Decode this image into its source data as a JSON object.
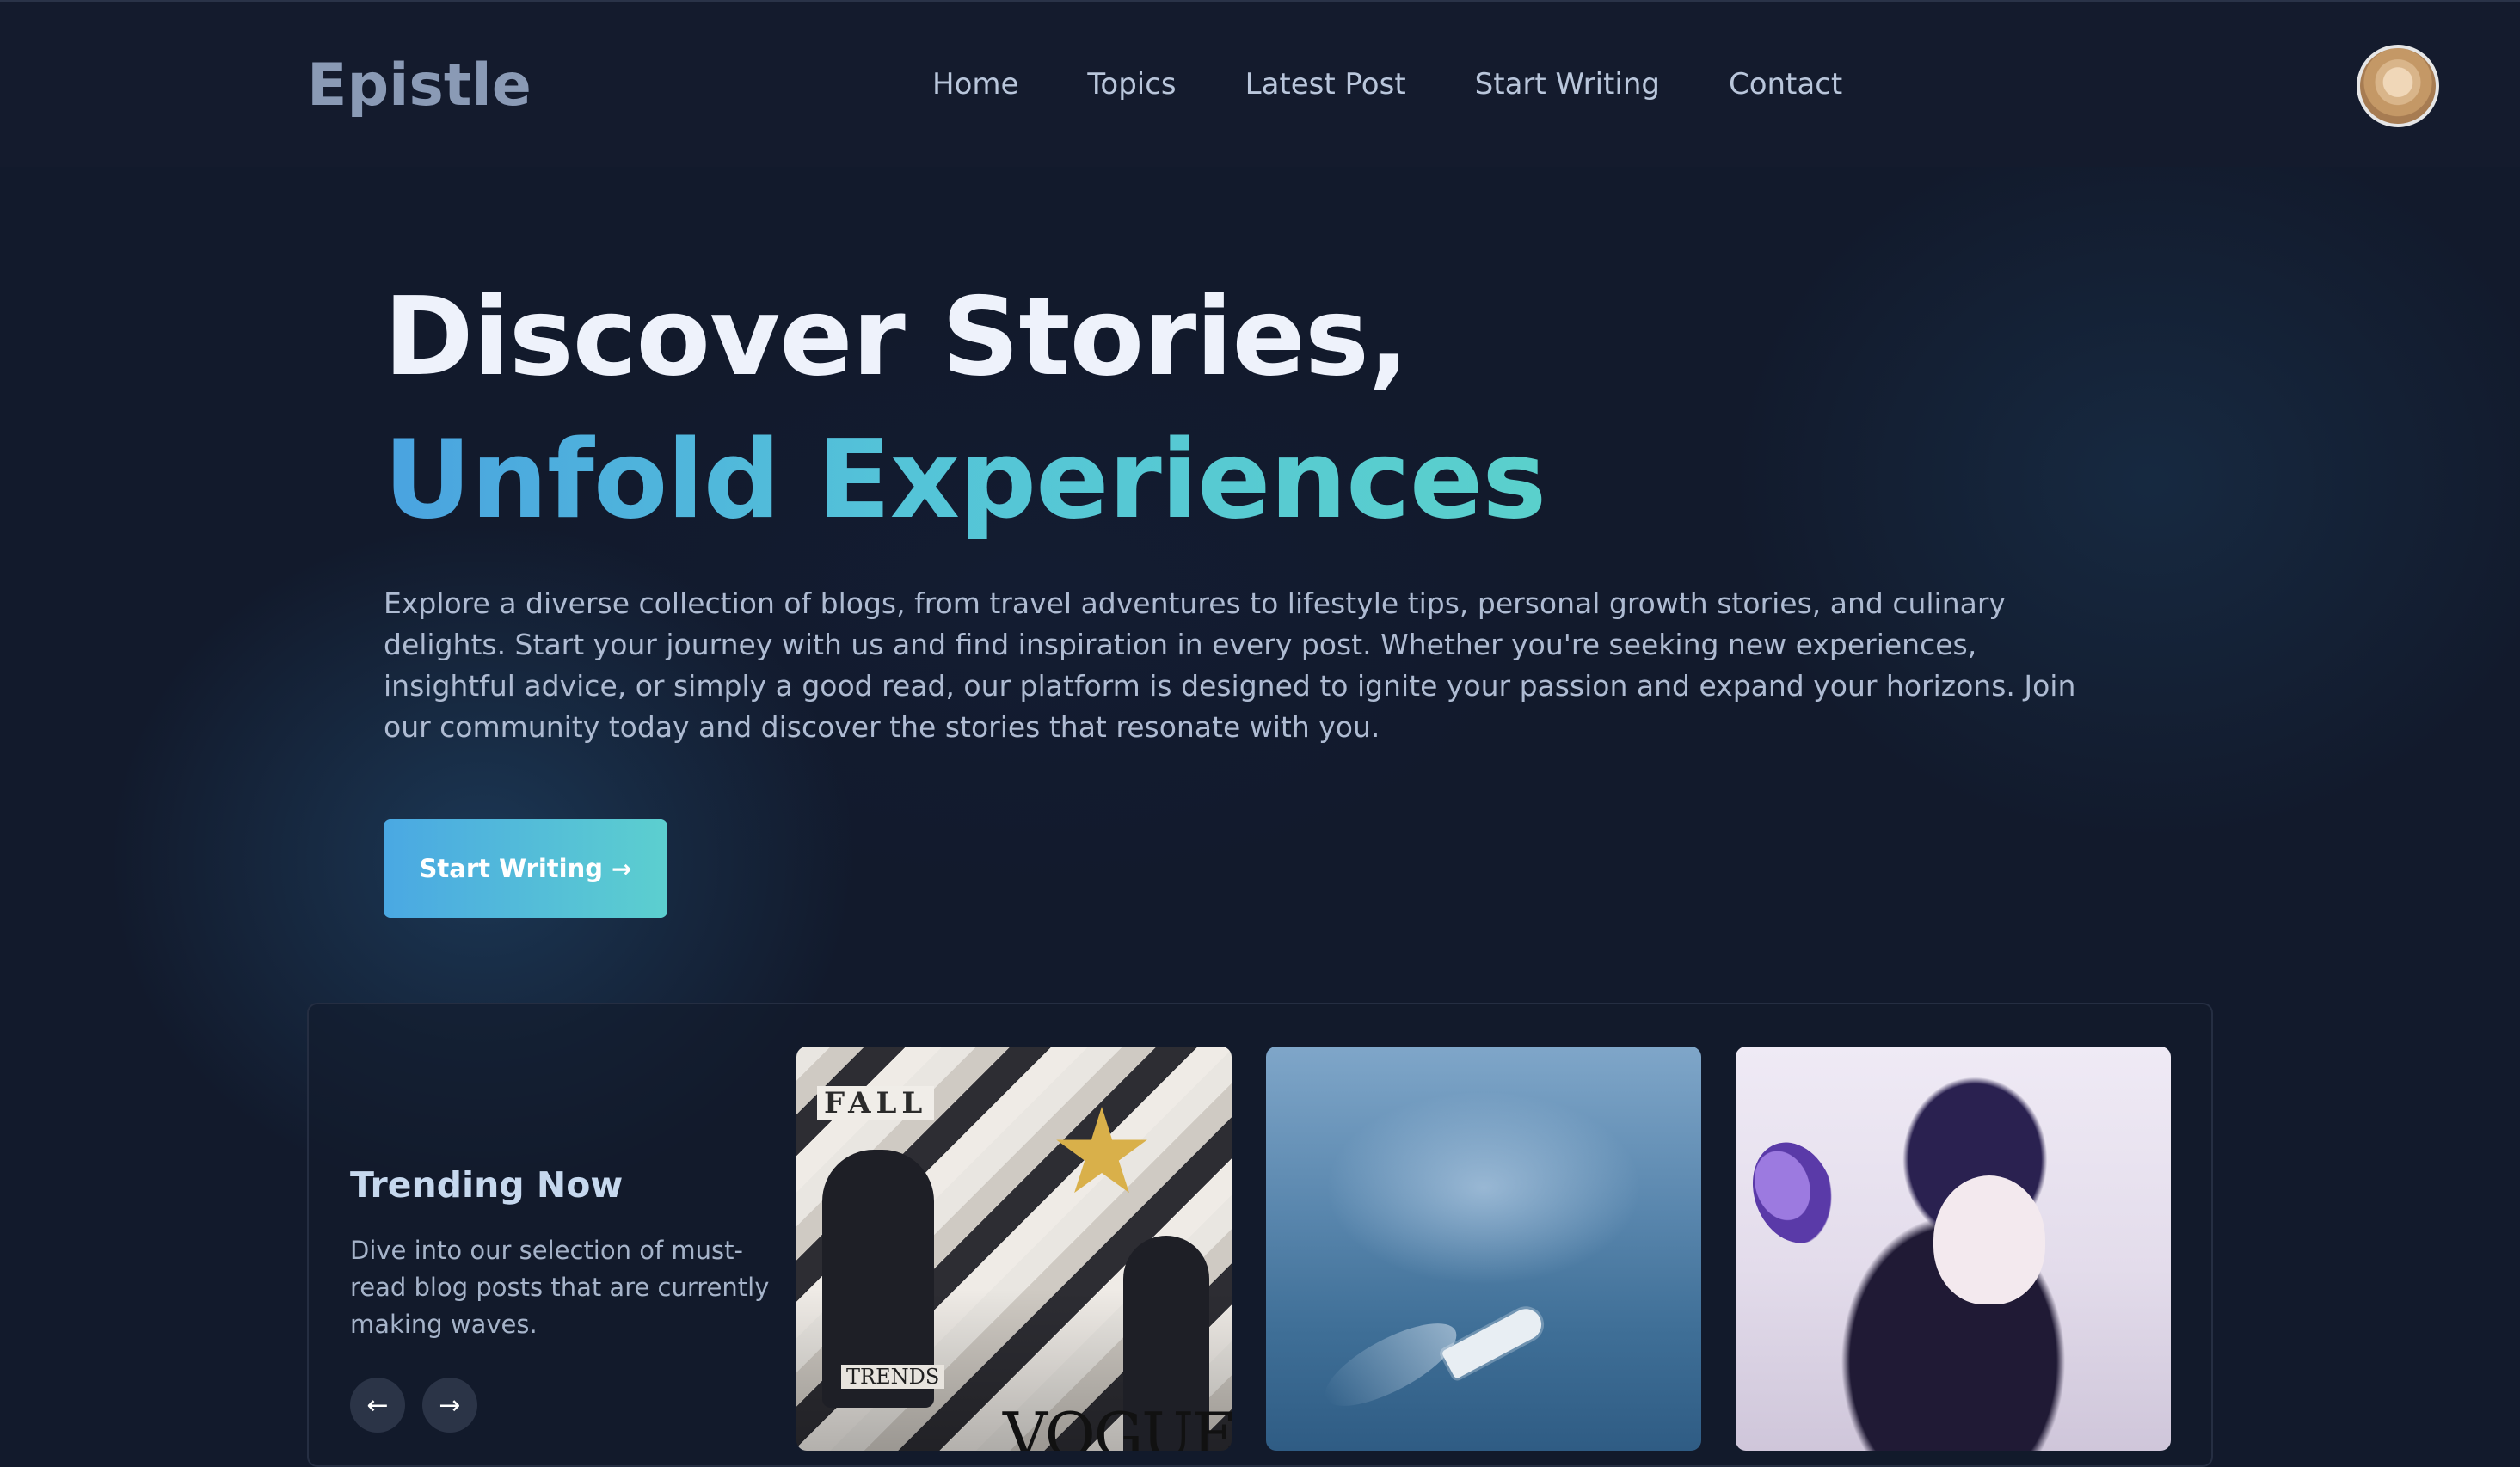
{
  "brand": {
    "name": "Epistle"
  },
  "nav": {
    "items": [
      {
        "label": "Home"
      },
      {
        "label": "Topics"
      },
      {
        "label": "Latest Post"
      },
      {
        "label": "Start Writing"
      },
      {
        "label": "Contact"
      }
    ]
  },
  "hero": {
    "title_line1": "Discover Stories,",
    "title_line2": "Unfold Experiences",
    "description": "Explore a diverse collection of blogs, from travel adventures to lifestyle tips, personal growth stories, and culinary delights. Start your journey with us and find inspiration in every post. Whether you're seeking new experiences, insightful advice, or simply a good read, our platform is designed to ignite your passion and expand your horizons. Join our community today and discover the stories that resonate with you.",
    "cta_label": "Start Writing",
    "cta_icon": "arrow-right-icon"
  },
  "trending": {
    "title": "Trending Now",
    "description": "Dive into our selection of must-read blog posts that are currently making waves.",
    "prev_icon": "arrow-left-icon",
    "next_icon": "arrow-right-icon",
    "cards": [
      {
        "image_labels": [
          "FALL",
          "TRENDS",
          "VOGUE"
        ]
      },
      {
        "image_labels": []
      },
      {
        "image_labels": []
      }
    ]
  },
  "colors": {
    "background": "#121a2c",
    "navbar": "#141b2d",
    "accent_start": "#4aa8e3",
    "accent_end": "#5ccfcf"
  }
}
